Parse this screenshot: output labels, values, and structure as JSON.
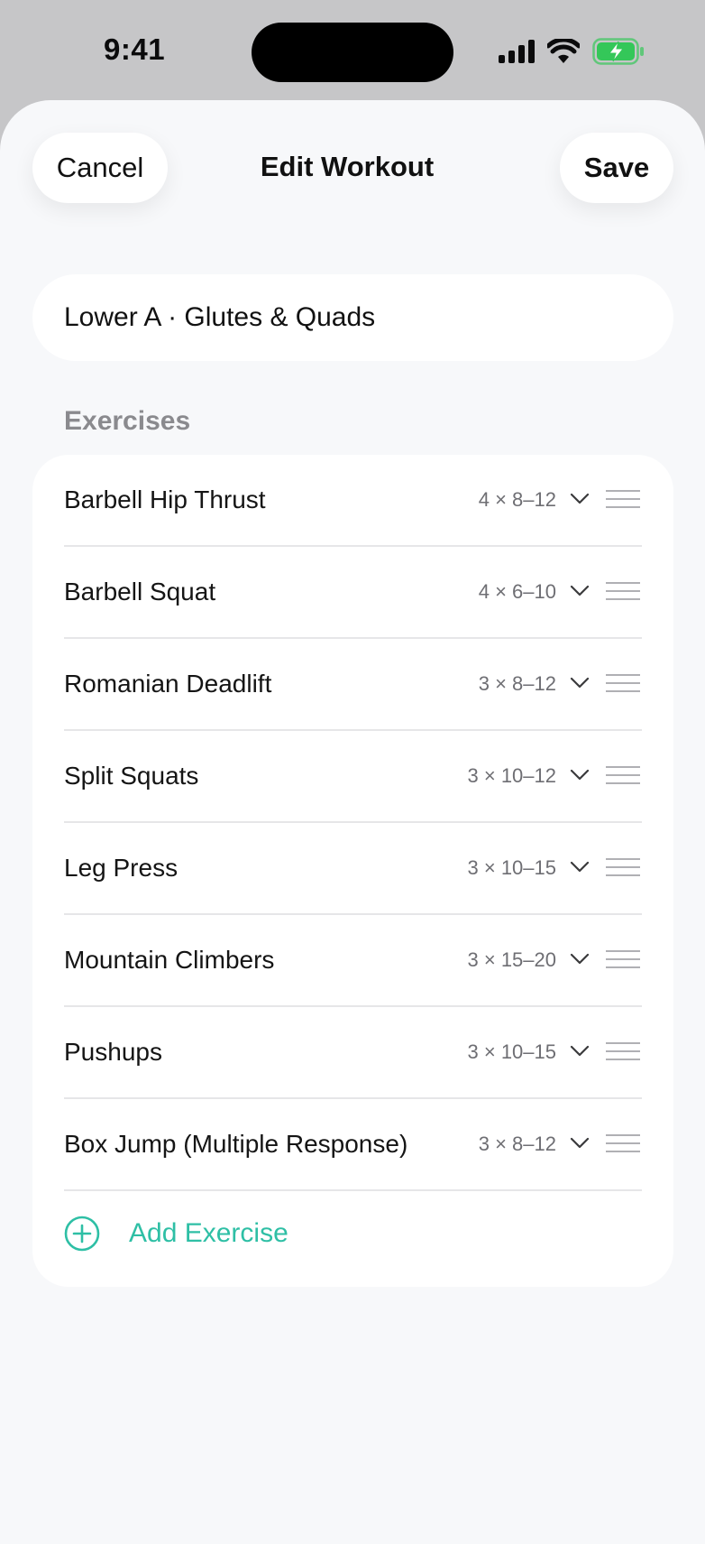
{
  "status_bar": {
    "time": "9:41",
    "icons": [
      "cellular-signal-icon",
      "wifi-icon",
      "battery-charging-icon"
    ]
  },
  "nav": {
    "cancel_label": "Cancel",
    "title": "Edit Workout",
    "save_label": "Save"
  },
  "workout": {
    "name": "Lower A · Glutes & Quads"
  },
  "exercises": {
    "section_label": "Exercises",
    "items": [
      {
        "name": "Barbell Hip Thrust",
        "sets": "4 × 8–12"
      },
      {
        "name": "Barbell Squat",
        "sets": "4 × 6–10"
      },
      {
        "name": "Romanian Deadlift",
        "sets": "3 × 8–12"
      },
      {
        "name": "Split Squats",
        "sets": "3 × 10–12"
      },
      {
        "name": "Leg Press",
        "sets": "3 × 10–15"
      },
      {
        "name": "Mountain Climbers",
        "sets": "3 × 15–20"
      },
      {
        "name": "Pushups",
        "sets": "3 × 10–15"
      },
      {
        "name": "Box Jump (Multiple Response)",
        "sets": "3 × 8–12"
      }
    ],
    "add_label": "Add Exercise"
  },
  "colors": {
    "accent": "#2ebfa5",
    "battery": "#34c759",
    "background": "#f7f8fa",
    "card": "#ffffff"
  }
}
